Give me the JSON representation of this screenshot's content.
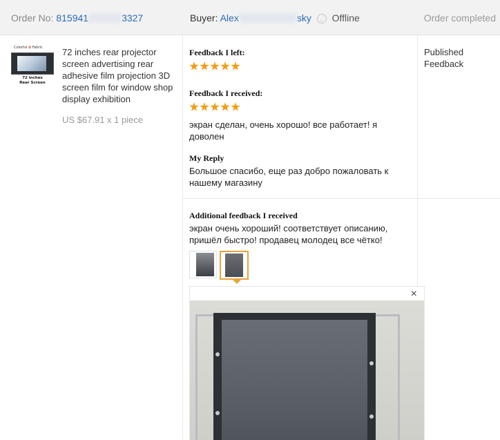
{
  "header": {
    "order_label": "Order No:",
    "order_no_start": "815941",
    "order_no_end": "3327",
    "buyer_label": "Buyer:",
    "buyer_name_start": "Alex",
    "buyer_name_end": "sky",
    "buyer_status": "Offline",
    "order_status": "Order completed"
  },
  "product": {
    "thumb_brand_a": "Colorful",
    "thumb_brand_b": "Fabric",
    "thumb_caption_1": "72 inches",
    "thumb_caption_2": "Rear Screen",
    "title": "72 inches rear projector screen advertising rear adhesive film projection 3D screen film for window shop display exhibition",
    "price": "US $67.91 x 1 piece"
  },
  "feedback": {
    "left_heading": "Feedback I left:",
    "left_stars": 5,
    "received_heading": "Feedback I received:",
    "received_stars": 5,
    "received_text": "экран сделан, очень хорошо! все работает! я доволен",
    "reply_heading": "My Reply",
    "reply_text": "Большое спасибо, еще раз добро пожаловать к нашему магазину",
    "additional_heading": "Additional feedback I received",
    "additional_text": "экран очень хороший! соответствует описанию, пришёл быстро! продавец молодец все чётко!",
    "photos_count": 2,
    "selected_photo": 2,
    "close_label": "×"
  },
  "status_column": {
    "published_label": "Published Feedback"
  },
  "colors": {
    "link": "#2a6ab8",
    "star": "#f39c12",
    "selected_border": "#e8a33c",
    "header_bg": "#f2f2f2"
  }
}
